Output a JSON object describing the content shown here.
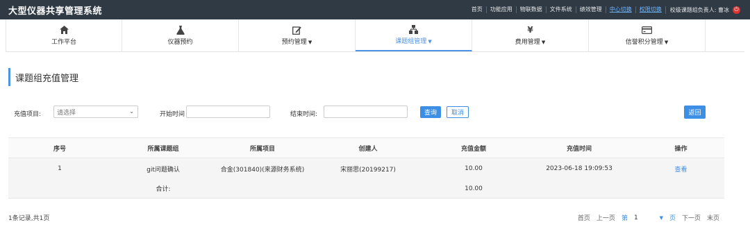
{
  "header": {
    "title": "大型仪器共享管理系统",
    "links": [
      "首页",
      "功能应用",
      "物联数据",
      "文件系统",
      "绩效管理",
      "中心切换",
      "权限切换"
    ],
    "user": "校级课题组负责人: 曹冰"
  },
  "nav": [
    {
      "label": "工作平台",
      "icon": "home-icon",
      "dropdown": false
    },
    {
      "label": "仪器预约",
      "icon": "flask-icon",
      "dropdown": false
    },
    {
      "label": "预约管理",
      "icon": "edit-icon",
      "dropdown": true
    },
    {
      "label": "课题组管理",
      "icon": "sitemap-icon",
      "dropdown": true,
      "active": true
    },
    {
      "label": "费用管理",
      "icon": "yen-icon",
      "dropdown": true
    },
    {
      "label": "信誉积分管理",
      "icon": "credit-card-icon",
      "dropdown": true
    }
  ],
  "page": {
    "title": "课题组充值管理"
  },
  "filters": {
    "project_label": "充值项目:",
    "project_value": "请选择",
    "start_label": "开始时间",
    "end_label": "结束时间:",
    "query": "查询",
    "cancel": "取消",
    "back": "返回"
  },
  "table": {
    "headers": [
      "序号",
      "所属课题组",
      "所属项目",
      "创建人",
      "充值金额",
      "充值时间",
      "操作"
    ],
    "rows": [
      {
        "index": "1",
        "group": "git问题确认",
        "project": "合金(301840)(来源财务系统)",
        "creator": "宋丽思(20199217)",
        "amount": "10.00",
        "time": "2023-06-18 19:09:53",
        "action": "查看"
      }
    ],
    "sum_label": "合计:",
    "sum_amount": "10.00"
  },
  "pagination": {
    "summary": "1条记录,共1页",
    "first": "首页",
    "prev": "上一页",
    "page_prefix": "第",
    "page_number": "1",
    "page_suffix": "页",
    "next": "下一页",
    "last": "末页"
  },
  "colors": {
    "accent": "#3d8fe6",
    "topbar": "#2f3a45",
    "power": "#e1322d"
  }
}
